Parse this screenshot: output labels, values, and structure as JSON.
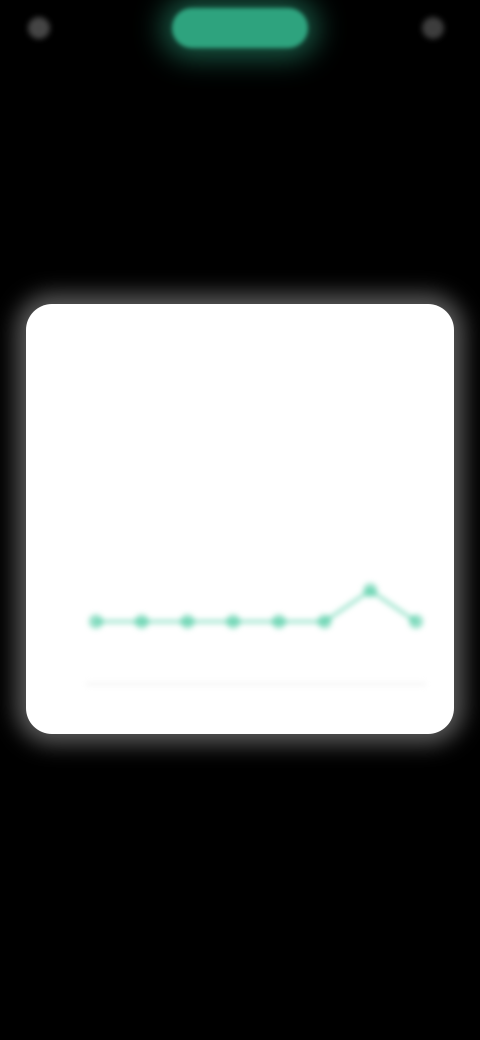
{
  "app": {
    "top_bar": {
      "left_label": "",
      "center_label": "",
      "right_label": ""
    }
  },
  "colors": {
    "background": "#000000",
    "accent": "#2ea37e",
    "card": "#ffffff",
    "line": "#27c28f"
  },
  "icons": {
    "left": "back-icon",
    "right": "menu-icon"
  },
  "card": {
    "title": "",
    "subtitle": ""
  },
  "chart_data": {
    "type": "line",
    "x": [
      1,
      2,
      3,
      4,
      5,
      6,
      7,
      8
    ],
    "series": [
      {
        "values": [
          1.2,
          1.2,
          1.2,
          1.2,
          1.2,
          1.2,
          1.8,
          1.2
        ]
      }
    ],
    "ylim": [
      0,
      5
    ],
    "grid": false
  }
}
